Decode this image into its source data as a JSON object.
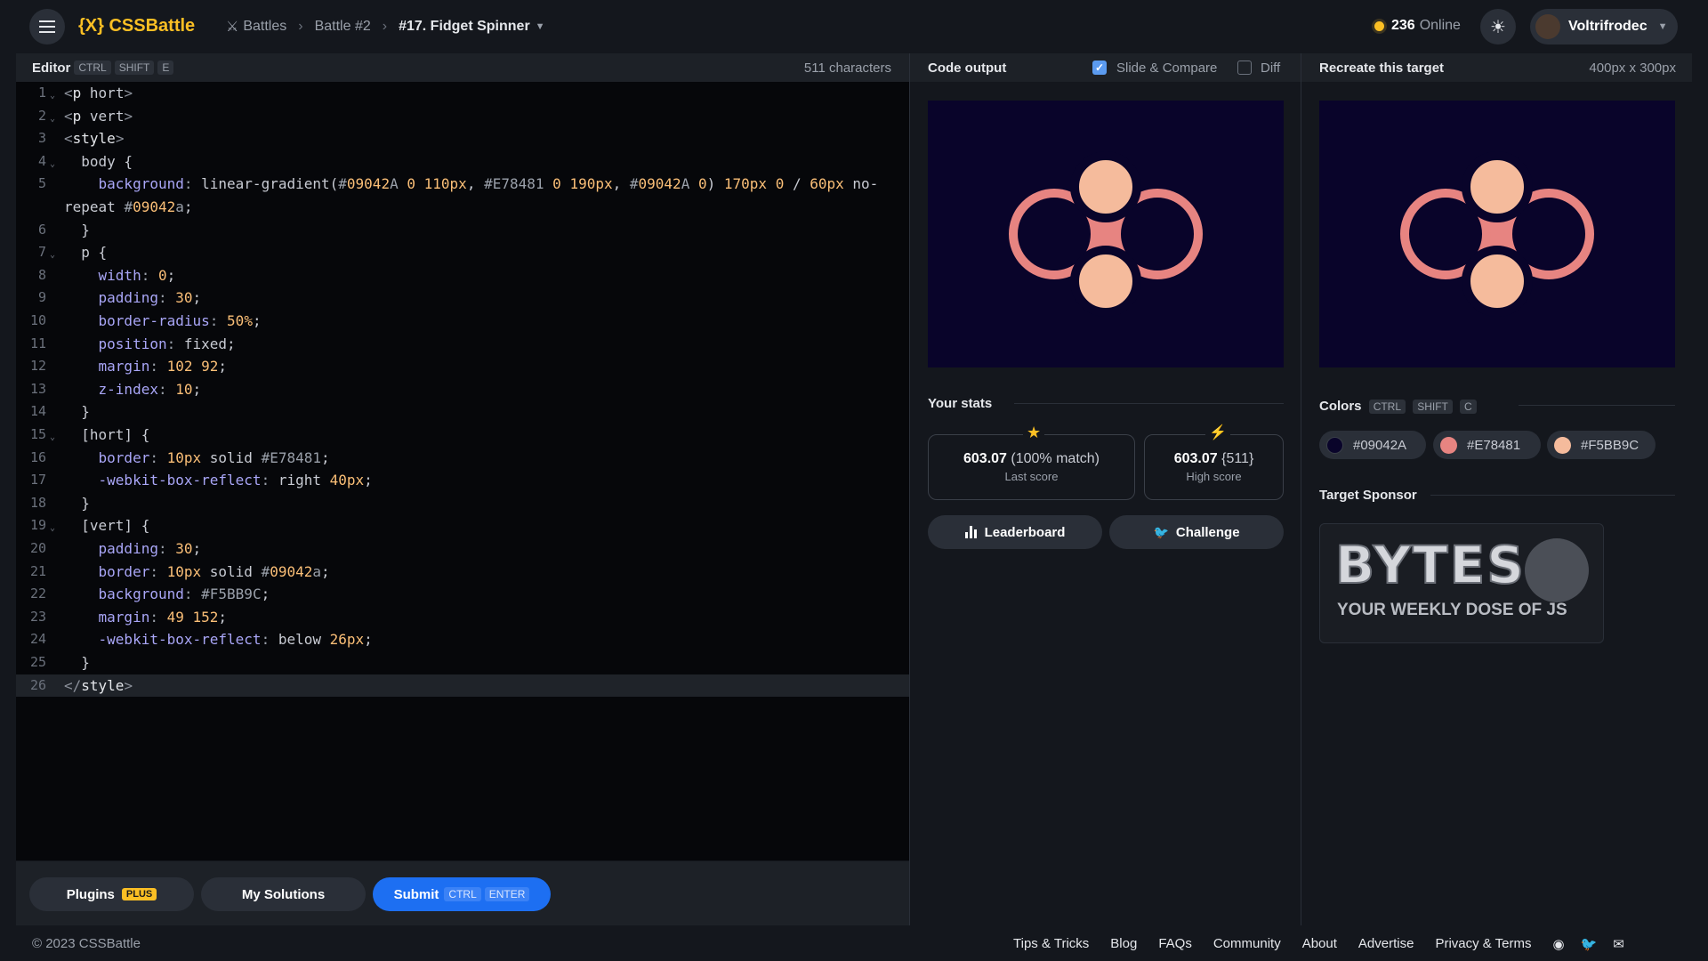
{
  "header": {
    "logo": "{X} CSSBattle",
    "breadcrumb": [
      "Battles",
      "Battle #2",
      "#17. Fidget Spinner"
    ],
    "online_count": "236",
    "online_label": "Online",
    "username": "Voltrifrodec"
  },
  "editor": {
    "title": "Editor",
    "shortcut": [
      "CTRL",
      "SHIFT",
      "E"
    ],
    "char_count": "511 characters",
    "lines": [
      "<p hort>",
      "<p vert>",
      "<style>",
      "  body {",
      "    background: linear-gradient(#09042A 0 110px, #E78481 0 190px, #09042A 0) 170px 0 / 60px no-",
      "repeat #09042a;",
      "  }",
      "  p {",
      "    width: 0;",
      "    padding: 30;",
      "    border-radius: 50%;",
      "    position: fixed;",
      "    margin: 102 92;",
      "    z-index: 10;",
      "  }",
      "  [hort] {",
      "    border: 10px solid #E78481;",
      "    -webkit-box-reflect: right 40px;",
      "  }",
      "  [vert] {",
      "    padding: 30;",
      "    border: 10px solid #09042a;",
      "    background: #F5BB9C;",
      "    margin: 49 152;",
      "    -webkit-box-reflect: below 26px;",
      "  }",
      "</style>"
    ],
    "line_numbers": [
      "1",
      "2",
      "3",
      "4",
      "5",
      "",
      "6",
      "7",
      "8",
      "9",
      "10",
      "11",
      "12",
      "13",
      "14",
      "15",
      "16",
      "17",
      "18",
      "19",
      "20",
      "21",
      "22",
      "23",
      "24",
      "25",
      "26"
    ]
  },
  "buttons": {
    "plugins": "Plugins",
    "plugins_badge": "PLUS",
    "my_solutions": "My Solutions",
    "submit": "Submit",
    "submit_kbd": [
      "CTRL",
      "ENTER"
    ]
  },
  "output": {
    "title": "Code output",
    "slide_compare": "Slide & Compare",
    "slide_compare_checked": true,
    "diff": "Diff",
    "diff_checked": false
  },
  "target": {
    "title": "Recreate this target",
    "size": "400px x 300px"
  },
  "stats": {
    "title": "Your stats",
    "last_score": "603.07",
    "last_match": "(100% match)",
    "last_label": "Last score",
    "high_score": "603.07",
    "high_chars": "{511}",
    "high_label": "High score",
    "leaderboard": "Leaderboard",
    "challenge": "Challenge"
  },
  "colors": {
    "title": "Colors",
    "shortcut": [
      "CTRL",
      "SHIFT",
      "C"
    ],
    "list": [
      "#09042A",
      "#E78481",
      "#F5BB9C"
    ]
  },
  "sponsor": {
    "title": "Target Sponsor",
    "line1": "BYTES",
    "line2": "YOUR WEEKLY DOSE OF JS"
  },
  "footer": {
    "copyright": "© 2023 CSSBattle",
    "links": [
      "Tips & Tricks",
      "Blog",
      "FAQs",
      "Community",
      "About",
      "Advertise",
      "Privacy & Terms"
    ]
  }
}
